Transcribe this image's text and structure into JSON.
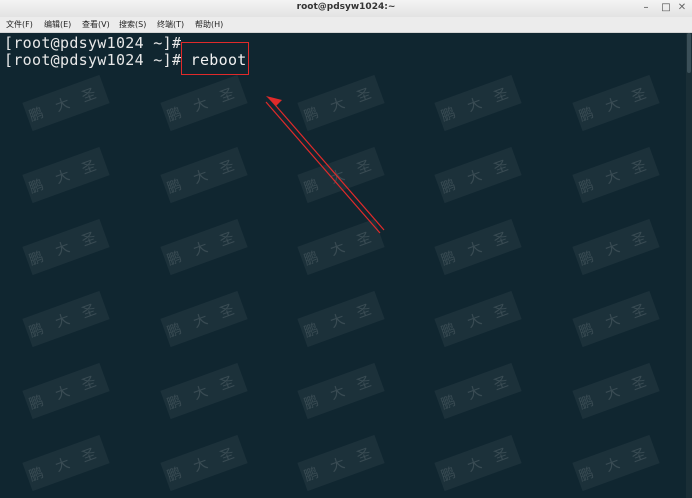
{
  "window": {
    "title": "root@pdsyw1024:~",
    "minimize": "–",
    "maximize": "□",
    "close": "✕"
  },
  "menubar": {
    "items": [
      {
        "label": "文件(F)"
      },
      {
        "label": "编辑(E)"
      },
      {
        "label": "查看(V)"
      },
      {
        "label": "搜索(S)"
      },
      {
        "label": "终端(T)"
      },
      {
        "label": "帮助(H)"
      }
    ]
  },
  "terminal": {
    "lines": [
      {
        "prompt": "[root@pdsyw1024 ~]#",
        "command": ""
      },
      {
        "prompt": "[root@pdsyw1024 ~]#",
        "command": "reboot"
      }
    ]
  },
  "annotation": {
    "box_color": "#e02a2a",
    "arrow_color": "#e02a2a"
  },
  "watermark": {
    "text": "鹏大圣"
  }
}
